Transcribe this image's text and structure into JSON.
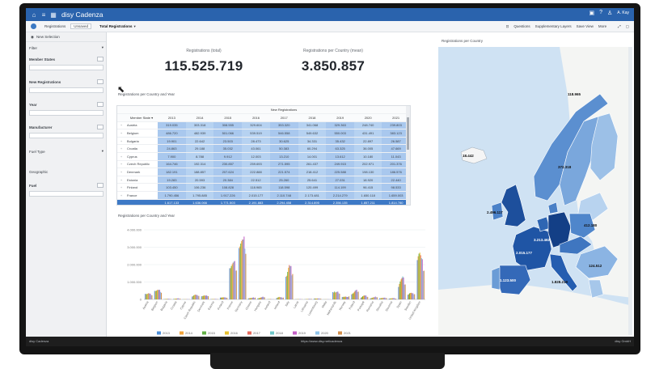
{
  "titlebar": {
    "app_title": "disy Cadenza",
    "icons": [
      "home-icon",
      "menu-icon",
      "grid-icon",
      "info-icon",
      "user-icon"
    ],
    "user": "A. Kay"
  },
  "toolbar": {
    "crumb": "Registrations",
    "pill": "Unsaved",
    "active_tab": "Total Registrations",
    "actions": [
      "Questions",
      "Supplementary Layers",
      "Save View",
      "More"
    ]
  },
  "sidebar": {
    "header": "New Selection",
    "filter_label": "Filter",
    "fields": [
      "Member States",
      "New Registrations",
      "Year",
      "Manufacturer",
      "Fuel Type",
      "Geographic",
      "Fuel"
    ]
  },
  "kpis": [
    {
      "label": "Registrations (total)",
      "value": "115.525.719"
    },
    {
      "label": "Registrations per Country (mean)",
      "value": "3.850.857"
    }
  ],
  "table_panel": {
    "title": "Registrations per Country and Year",
    "group_header": "New Registrations",
    "first_col": "Member State",
    "years": [
      "2013",
      "2014",
      "2015",
      "2016",
      "2017",
      "2018",
      "2019",
      "2020",
      "2021"
    ],
    "rows": [
      {
        "name": "Austria",
        "values": [
          "319.035",
          "303.318",
          "308.555",
          "329.604",
          "353.320",
          "341.068",
          "329.363",
          "248.740",
          "239.803"
        ]
      },
      {
        "name": "Belgium",
        "values": [
          "486.720",
          "482.939",
          "501.066",
          "539.519",
          "546.558",
          "549.632",
          "550.003",
          "431.491",
          "383.123"
        ]
      },
      {
        "name": "Bulgaria",
        "values": [
          "19.901",
          "22.642",
          "23.503",
          "28.473",
          "30.625",
          "34.331",
          "35.432",
          "22.897",
          "26.587"
        ]
      },
      {
        "name": "Croatia",
        "values": [
          "24.863",
          "29.188",
          "35.032",
          "43.061",
          "50.383",
          "60.294",
          "63.325",
          "36.005",
          "47.669"
        ]
      },
      {
        "name": "Cyprus",
        "values": [
          "7.900",
          "8.788",
          "9.912",
          "12.003",
          "13.210",
          "14.001",
          "13.612",
          "10.180",
          "11.043"
        ]
      },
      {
        "name": "Czech Republic",
        "values": [
          "164.746",
          "192.314",
          "230.857",
          "259.693",
          "271.595",
          "261.437",
          "249.915",
          "202.971",
          "201.376"
        ]
      },
      {
        "name": "Denmark",
        "values": [
          "182.191",
          "188.857",
          "207.624",
          "222.888",
          "221.574",
          "218.412",
          "225.588",
          "198.130",
          "186.576"
        ]
      },
      {
        "name": "Estonia",
        "values": [
          "19.283",
          "20.593",
          "20.384",
          "22.512",
          "25.260",
          "25.641",
          "27.031",
          "18.920",
          "22.440"
        ]
      },
      {
        "name": "Finland",
        "values": [
          "103.450",
          "106.236",
          "108.828",
          "118.965",
          "118.598",
          "120.499",
          "114.199",
          "96.415",
          "98.533"
        ]
      },
      {
        "name": "France",
        "values": [
          "1.790.456",
          "1.795.885",
          "1.917.226",
          "2.015.177",
          "2.110.748",
          "2.173.481",
          "2.214.279",
          "1.650.118",
          "1.659.003"
        ]
      }
    ],
    "total_row": [
      "1.617.133",
      "1.636.066",
      "1.771.503",
      "2.191.883",
      "2.294.458",
      "2.314.895",
      "2.356.135",
      "1.857.211",
      "1.814.780"
    ]
  },
  "chart_panel": {
    "title": "Registrations per Country and Year"
  },
  "chart_data": {
    "type": "bar",
    "title": "",
    "ylim": [
      0,
      4000000
    ],
    "yticks": [
      "0",
      "1.000.000",
      "2.000.000",
      "3.000.000",
      "4.000.000"
    ],
    "legend_position": "bottom",
    "categories": [
      "Austria",
      "Belgium",
      "Bulgaria",
      "Croatia",
      "Cyprus",
      "Czech Republic",
      "Denmark",
      "Estonia",
      "Finland",
      "France",
      "Germany",
      "Greece",
      "Hungary",
      "Iceland",
      "Ireland",
      "Italy",
      "Latvia",
      "Lithuania",
      "Luxembourg",
      "Malta",
      "Netherlands",
      "Norway",
      "Poland",
      "Portugal",
      "Romania",
      "Slovakia",
      "Slovenia",
      "Spain",
      "Sweden",
      "United Kingdom"
    ],
    "series": [
      {
        "name": "2013",
        "color": "#4e8fd9",
        "values": [
          320000,
          490000,
          20000,
          25000,
          8000,
          165000,
          180000,
          20000,
          105000,
          1790000,
          2950000,
          60000,
          60000,
          8000,
          75000,
          1300000,
          10000,
          12000,
          46000,
          6000,
          420000,
          140000,
          290000,
          100000,
          60000,
          66000,
          50000,
          720000,
          270000,
          2260000
        ]
      },
      {
        "name": "2014",
        "color": "#f0a33a",
        "values": [
          305000,
          482000,
          22000,
          29000,
          9000,
          192000,
          189000,
          21000,
          106000,
          1800000,
          3040000,
          70000,
          70000,
          10000,
          95000,
          1360000,
          12000,
          15000,
          50000,
          7000,
          390000,
          145000,
          330000,
          140000,
          70000,
          72000,
          54000,
          890000,
          300000,
          2480000
        ]
      },
      {
        "name": "2015",
        "color": "#62b045",
        "values": [
          310000,
          500000,
          24000,
          35000,
          10000,
          230000,
          208000,
          20000,
          109000,
          1920000,
          3210000,
          76000,
          80000,
          15000,
          125000,
          1580000,
          14000,
          18000,
          46000,
          8000,
          450000,
          150000,
          355000,
          180000,
          95000,
          78000,
          60000,
          1030000,
          350000,
          2630000
        ]
      },
      {
        "name": "2016",
        "color": "#e7c02f",
        "values": [
          330000,
          540000,
          28000,
          43000,
          12000,
          260000,
          223000,
          22000,
          119000,
          2020000,
          3350000,
          80000,
          100000,
          18000,
          145000,
          1820000,
          17000,
          21000,
          50000,
          8000,
          390000,
          155000,
          415000,
          210000,
          110000,
          86000,
          65000,
          1150000,
          370000,
          2690000
        ]
      },
      {
        "name": "2017",
        "color": "#e56a5c",
        "values": [
          355000,
          547000,
          31000,
          50000,
          13000,
          272000,
          222000,
          25000,
          119000,
          2110000,
          3440000,
          88000,
          115000,
          21000,
          130000,
          1970000,
          18000,
          25000,
          52000,
          9000,
          415000,
          160000,
          485000,
          225000,
          125000,
          95000,
          70000,
          1230000,
          380000,
          2540000
        ]
      },
      {
        "name": "2018",
        "color": "#6fc7c9",
        "values": [
          340000,
          550000,
          34000,
          60000,
          14000,
          261000,
          218000,
          26000,
          120000,
          2170000,
          3440000,
          103000,
          130000,
          17000,
          125000,
          1910000,
          19000,
          32000,
          52000,
          9000,
          445000,
          148000,
          530000,
          228000,
          130000,
          98000,
          72000,
          1320000,
          354000,
          2370000
        ]
      },
      {
        "name": "2019",
        "color": "#c35fc5",
        "values": [
          330000,
          550000,
          35000,
          63000,
          14000,
          250000,
          226000,
          27000,
          114000,
          2210000,
          3610000,
          114000,
          157000,
          12000,
          117000,
          1920000,
          19000,
          33000,
          55000,
          9000,
          446000,
          142000,
          555000,
          224000,
          161000,
          101000,
          73000,
          1260000,
          356000,
          2310000
        ]
      },
      {
        "name": "2020",
        "color": "#8fc4ea",
        "values": [
          249000,
          431000,
          23000,
          36000,
          10000,
          203000,
          198000,
          19000,
          96000,
          1650000,
          2920000,
          80000,
          128000,
          8000,
          88000,
          1380000,
          14000,
          28000,
          45000,
          6000,
          356000,
          141000,
          428000,
          146000,
          126000,
          76000,
          48000,
          851000,
          292000,
          1630000
        ]
      },
      {
        "name": "2021",
        "color": "#d28e4b",
        "values": [
          240000,
          383000,
          27000,
          48000,
          11000,
          201000,
          187000,
          22000,
          99000,
          1660000,
          2620000,
          103000,
          121000,
          11000,
          105000,
          1460000,
          17000,
          33000,
          44000,
          5000,
          323000,
          176000,
          446000,
          146000,
          125000,
          76000,
          47000,
          860000,
          301000,
          1650000
        ]
      }
    ]
  },
  "map_panel": {
    "title": "Registrations per Country",
    "labels": [
      {
        "key": "uk",
        "text": "2.496.117"
      },
      {
        "key": "de",
        "text": "3.213.462"
      },
      {
        "key": "fr",
        "text": "2.015.177"
      },
      {
        "key": "it",
        "text": "1.828.219"
      },
      {
        "key": "es",
        "text": "1.123.500"
      },
      {
        "key": "pl",
        "text": "412.180"
      },
      {
        "key": "se",
        "text": "372.318"
      },
      {
        "key": "fi",
        "text": "118.965"
      },
      {
        "key": "is",
        "text": "18.442"
      },
      {
        "key": "ro",
        "text": "124.512"
      }
    ]
  },
  "statusbar": {
    "left": "disy Cadenza",
    "center": "https://www.disy.net/cadenza",
    "right": "disy GmbH"
  }
}
